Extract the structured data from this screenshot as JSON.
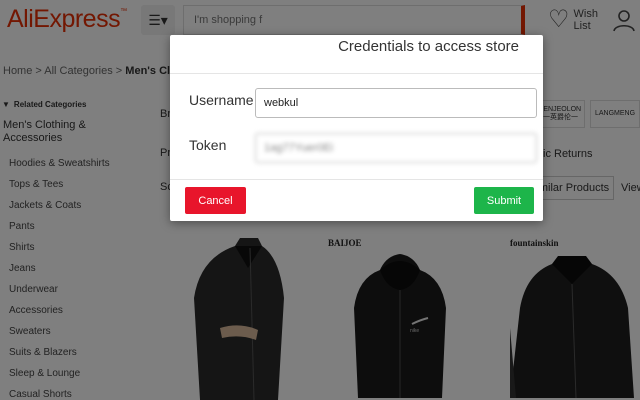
{
  "header": {
    "logo": "AliExpress",
    "logo_mark": "™",
    "search_placeholder": "I'm shopping f",
    "wish_line1": "Wish",
    "wish_line2": "List"
  },
  "breadcrumb": {
    "prefix": "Home > All Categories > ",
    "current": "Men's Clothing"
  },
  "sidebar": {
    "title": "Related Categories",
    "main": "Men's Clothing & Accessories",
    "items": [
      "Hoodies & Sweatshirts",
      "Tops & Tees",
      "Jackets & Coats",
      "Pants",
      "Shirts",
      "Jeans",
      "Underwear",
      "Accessories",
      "Sweaters",
      "Suits & Blazers",
      "Sleep & Lounge",
      "Casual Shorts"
    ]
  },
  "content": {
    "brands_label": "Br",
    "price_label": "Pri",
    "sort_label": "Sc",
    "returns_text": "ic Returns",
    "brand_1": "JENJEOLON",
    "brand_1_sub": "一英爵伦一",
    "brand_2": "LANGMENG",
    "similar_btn": "milar Products",
    "view_label": "View",
    "product_brand_1": "BAIJOE",
    "product_brand_2": "fountainskin",
    "jacket_logo": "nike"
  },
  "modal": {
    "title": "Credentials to access store",
    "username_label": "Username",
    "username_value": "webkul",
    "token_label": "Token",
    "token_value": "1ag77Yuer0Ei",
    "cancel_label": "Cancel",
    "submit_label": "Submit"
  },
  "colors": {
    "brand": "#e62e04",
    "cancel": "#e8152b",
    "submit": "#1db54a"
  }
}
